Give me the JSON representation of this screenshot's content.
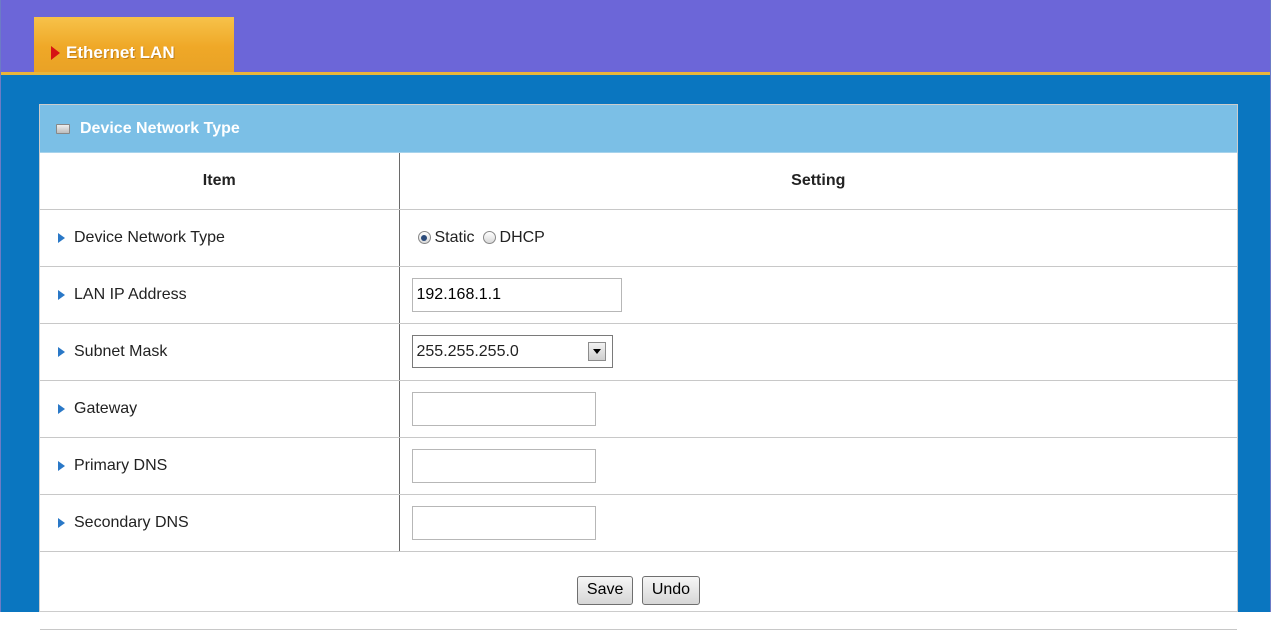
{
  "header": {
    "tab_label": "Ethernet LAN"
  },
  "panel": {
    "title": "Device Network Type",
    "columns": {
      "item": "Item",
      "setting": "Setting"
    },
    "rows": {
      "network_type": {
        "label": "Device Network Type",
        "options": [
          "Static",
          "DHCP"
        ],
        "selected": "Static"
      },
      "lan_ip": {
        "label": "LAN IP Address",
        "value": "192.168.1.1"
      },
      "subnet": {
        "label": "Subnet Mask",
        "value": "255.255.255.0"
      },
      "gateway": {
        "label": "Gateway",
        "value": ""
      },
      "primary_dns": {
        "label": "Primary DNS",
        "value": ""
      },
      "secondary_dns": {
        "label": "Secondary DNS",
        "value": ""
      }
    },
    "buttons": {
      "save": "Save",
      "undo": "Undo"
    }
  },
  "colors": {
    "top_bar": "#6c66d8",
    "tab": "#efa827",
    "background": "#0a76c0",
    "panel_header": "#7bbfe6",
    "bullet": "#2a78c7"
  },
  "icons": {
    "tab_arrow": "triangle-right-icon",
    "panel_header": "panel-icon",
    "row_bullet": "bullet-arrow-icon"
  }
}
